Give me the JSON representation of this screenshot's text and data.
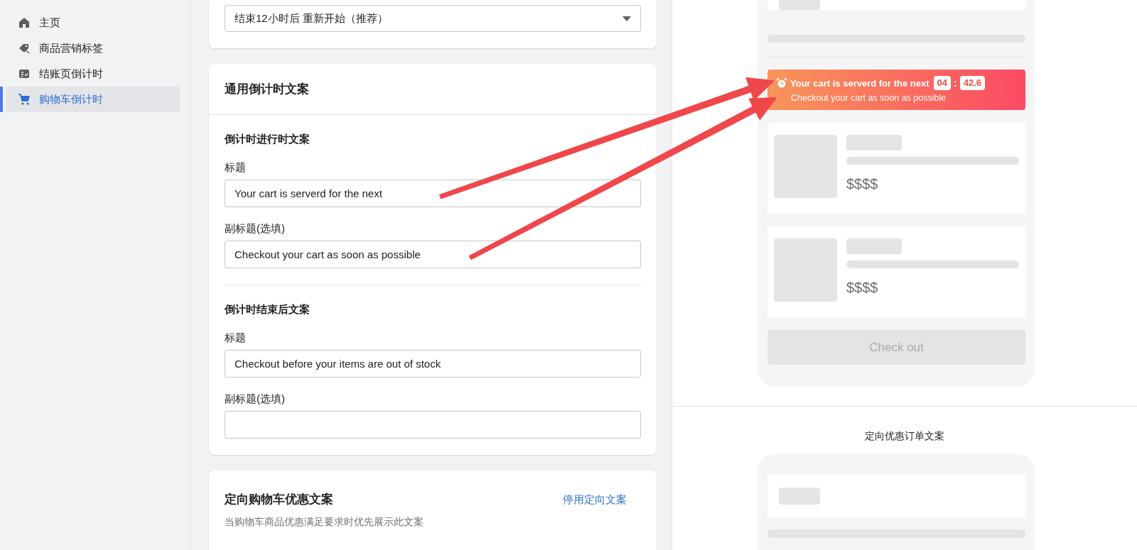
{
  "sidebar": {
    "items": [
      {
        "label": "主页",
        "selected": false
      },
      {
        "label": "商品营销标签",
        "selected": false
      },
      {
        "label": "结账页倒计时",
        "selected": false
      },
      {
        "label": "购物车倒计时",
        "selected": true
      }
    ]
  },
  "restart_select": {
    "value": "结束12小时后 重新开始（推荐）"
  },
  "countdown_copy_card": {
    "title": "通用倒计时文案",
    "sections": [
      {
        "heading": "倒计时进行时文案",
        "fields": [
          {
            "label": "标题",
            "value": "Your cart is serverd for the next"
          },
          {
            "label": "副标题(选填)",
            "value": "Checkout your cart as soon as possible"
          }
        ]
      },
      {
        "heading": "倒计时结束后文案",
        "fields": [
          {
            "label": "标题",
            "value": "Checkout before your items are out of stock"
          },
          {
            "label": "副标题(选填)"
          }
        ]
      }
    ]
  },
  "targeted_card": {
    "title": "定向购物车优惠文案",
    "link": "停用定向文案",
    "description": "当购物车商品优惠满足要求时优先展示此文案"
  },
  "preview": {
    "banner": {
      "title": "Your cart is serverd for the next",
      "minutes": "04",
      "separator": ":",
      "seconds": "42.6",
      "subtitle": "Checkout your cart as soon as possible"
    },
    "products": [
      {
        "price": "$$$$"
      },
      {
        "price": "$$$$"
      }
    ],
    "checkout_button": "Check out"
  },
  "targeted_preview": {
    "title": "定向优惠订单文案"
  }
}
